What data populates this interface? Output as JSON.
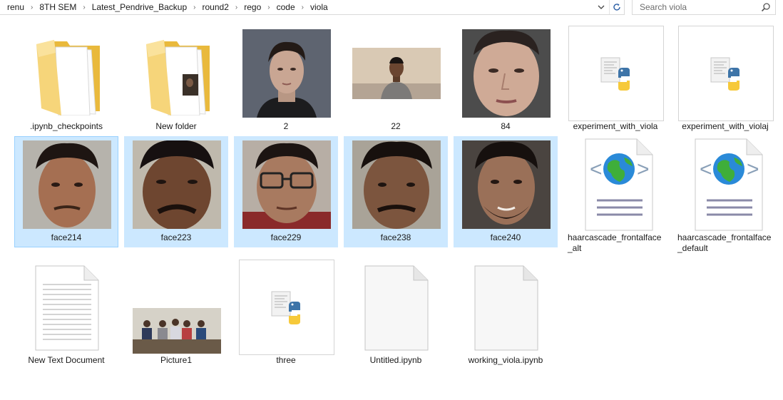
{
  "breadcrumb": [
    "renu",
    "8TH SEM",
    "Latest_Pendrive_Backup",
    "round2",
    "rego",
    "code",
    "viola"
  ],
  "search": {
    "placeholder": "Search viola"
  },
  "files": [
    {
      "name": ".ipynb_checkpoints",
      "kind": "folder"
    },
    {
      "name": "New folder",
      "kind": "folder-with-photo"
    },
    {
      "name": "2",
      "kind": "photo-face"
    },
    {
      "name": "22",
      "kind": "photo-person"
    },
    {
      "name": "84",
      "kind": "photo-face"
    },
    {
      "name": "experiment_with_viola",
      "kind": "python-file"
    },
    {
      "name": "experiment_with_violaj",
      "kind": "python-file"
    },
    {
      "name": "face214",
      "kind": "photo-face",
      "selected": true
    },
    {
      "name": "face223",
      "kind": "photo-face",
      "selected": true
    },
    {
      "name": "face229",
      "kind": "photo-face",
      "selected": true
    },
    {
      "name": "face238",
      "kind": "photo-face",
      "selected": true
    },
    {
      "name": "face240",
      "kind": "photo-face",
      "selected": true
    },
    {
      "name": "haarcascade_frontalface_alt",
      "kind": "xml-file"
    },
    {
      "name": "haarcascade_frontalface_default",
      "kind": "xml-file"
    },
    {
      "name": "New Text Document",
      "kind": "text-file"
    },
    {
      "name": "Picture1",
      "kind": "photo-group"
    },
    {
      "name": "three",
      "kind": "python-file"
    },
    {
      "name": "Untitled.ipynb",
      "kind": "blank-file"
    },
    {
      "name": "working_viola.ipynb",
      "kind": "blank-file"
    }
  ],
  "colors": {
    "selection": "#cce8ff",
    "selection_border": "#99d1ff",
    "folder": "#f7d57a"
  },
  "icons": {
    "dropdown": "chevron-down-icon",
    "refresh": "refresh-icon",
    "search": "search-icon"
  }
}
